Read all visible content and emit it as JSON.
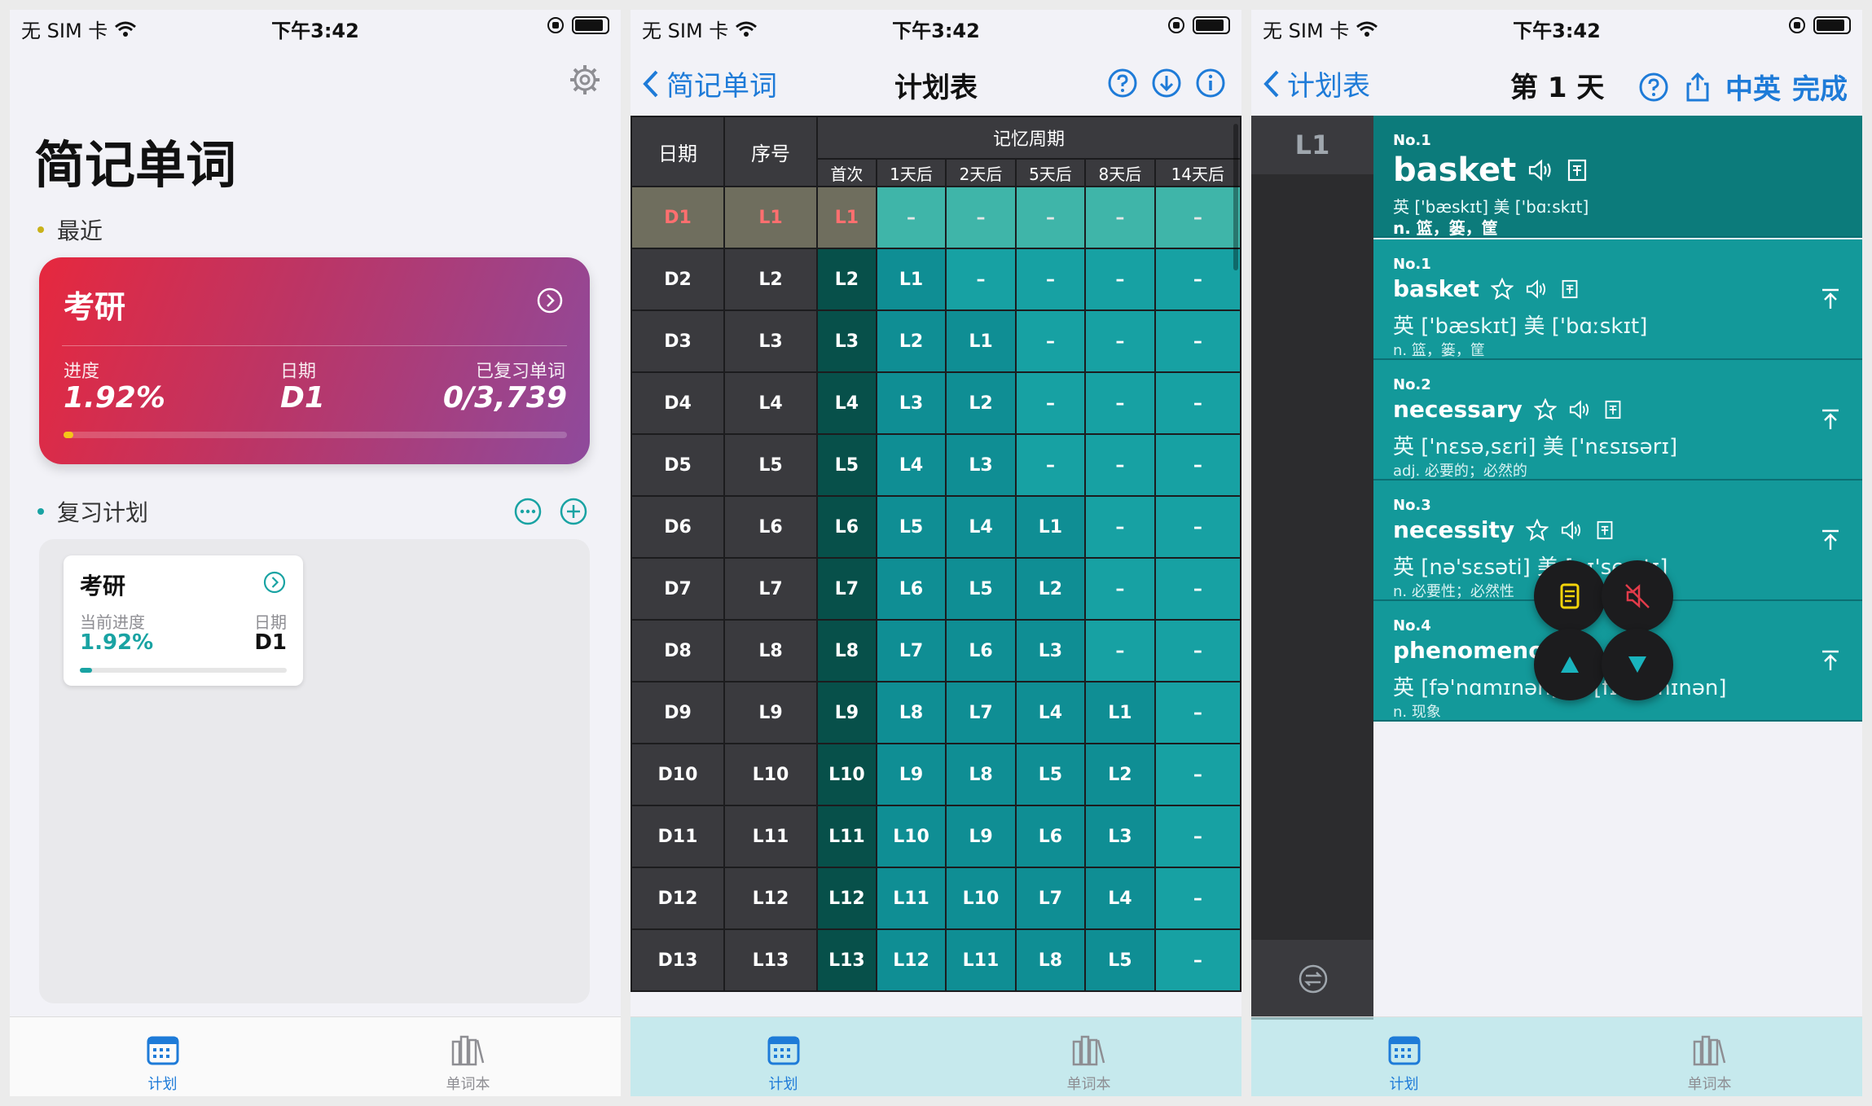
{
  "status": {
    "carrier": "无 SIM 卡",
    "time": "下午3:42"
  },
  "tabbar": {
    "plan": "计划",
    "wordbook": "单词本"
  },
  "home": {
    "title": "简记单词",
    "recent_label": "最近",
    "card": {
      "title": "考研",
      "progress_label": "进度",
      "progress_value": "1.92%",
      "date_label": "日期",
      "date_value": "D1",
      "reviewed_label": "已复习单词",
      "reviewed_value": "0/3,739",
      "progress_fraction": 0.0192
    },
    "review_label": "复习计划",
    "mini": {
      "title": "考研",
      "progress_label": "当前进度",
      "progress_value": "1.92%",
      "date_label": "日期",
      "date_value": "D1"
    }
  },
  "plan": {
    "back": "简记单词",
    "title": "计划表",
    "headers": {
      "date": "日期",
      "seq": "序号",
      "cycle": "记忆周期",
      "cols": [
        "首次",
        "1天后",
        "2天后",
        "5天后",
        "8天后",
        "14天后"
      ]
    },
    "rows": [
      {
        "d": "D1",
        "l": "L1",
        "c": [
          "L1",
          "–",
          "–",
          "–",
          "–",
          "–"
        ]
      },
      {
        "d": "D2",
        "l": "L2",
        "c": [
          "L2",
          "L1",
          "–",
          "–",
          "–",
          "–"
        ]
      },
      {
        "d": "D3",
        "l": "L3",
        "c": [
          "L3",
          "L2",
          "L1",
          "–",
          "–",
          "–"
        ]
      },
      {
        "d": "D4",
        "l": "L4",
        "c": [
          "L4",
          "L3",
          "L2",
          "–",
          "–",
          "–"
        ]
      },
      {
        "d": "D5",
        "l": "L5",
        "c": [
          "L5",
          "L4",
          "L3",
          "–",
          "–",
          "–"
        ]
      },
      {
        "d": "D6",
        "l": "L6",
        "c": [
          "L6",
          "L5",
          "L4",
          "L1",
          "–",
          "–"
        ]
      },
      {
        "d": "D7",
        "l": "L7",
        "c": [
          "L7",
          "L6",
          "L5",
          "L2",
          "–",
          "–"
        ]
      },
      {
        "d": "D8",
        "l": "L8",
        "c": [
          "L8",
          "L7",
          "L6",
          "L3",
          "–",
          "–"
        ]
      },
      {
        "d": "D9",
        "l": "L9",
        "c": [
          "L9",
          "L8",
          "L7",
          "L4",
          "L1",
          "–"
        ]
      },
      {
        "d": "D10",
        "l": "L10",
        "c": [
          "L10",
          "L9",
          "L8",
          "L5",
          "L2",
          "–"
        ]
      },
      {
        "d": "D11",
        "l": "L11",
        "c": [
          "L11",
          "L10",
          "L9",
          "L6",
          "L3",
          "–"
        ]
      },
      {
        "d": "D12",
        "l": "L12",
        "c": [
          "L12",
          "L11",
          "L10",
          "L7",
          "L4",
          "–"
        ]
      },
      {
        "d": "D13",
        "l": "L13",
        "c": [
          "L13",
          "L12",
          "L11",
          "L8",
          "L5",
          "–"
        ]
      }
    ]
  },
  "day": {
    "back": "计划表",
    "title": "第 1 天",
    "lang_toggle": "中英",
    "done": "完成",
    "list_label": "L1",
    "header_word": {
      "no": "No.1",
      "word": "basket",
      "phon": "英 ['bæskɪt] 美 ['bɑːskɪt]",
      "mean": "n. 篮，篓，筐"
    },
    "words": [
      {
        "no": "No.1",
        "word": "basket",
        "phon": "英 ['bæskɪt] 美 ['bɑːskɪt]",
        "mean": "n. 篮，篓，筐"
      },
      {
        "no": "No.2",
        "word": "necessary",
        "phon": "英 ['nɛsə,sɛri] 美 ['nɛsɪsərɪ]",
        "mean": "adj. 必要的；必然的"
      },
      {
        "no": "No.3",
        "word": "necessity",
        "phon": "英 [nə'sɛsəti] 美 [nɪ'sesɪtɪ]",
        "mean": "n. 必要性；必然性"
      },
      {
        "no": "No.4",
        "word": "phenomenon",
        "phon": "英 [fə'nɑmɪnən] 美 [fɪ'nɒmɪnən]",
        "mean": "n. 现象"
      }
    ]
  },
  "colors": {
    "accent": "#1e7bd8",
    "teal": "#13999a",
    "card_start": "#e6283e",
    "card_end": "#8e4a9c"
  }
}
